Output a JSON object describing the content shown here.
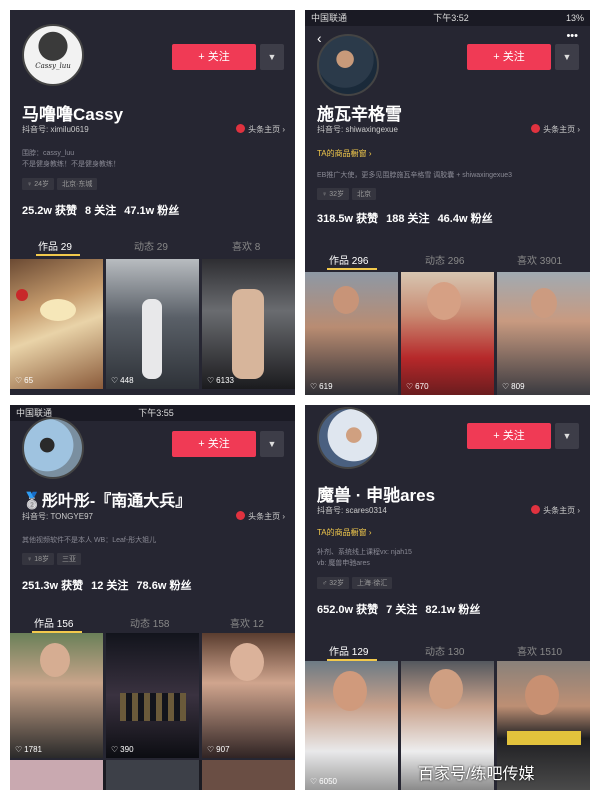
{
  "watermark": "百家号/练吧传媒",
  "labels": {
    "follow": "+ 关注",
    "dropdown": "▼",
    "toutiao": "头条主页 ›",
    "shop": "TA的商品橱窗 ›",
    "heart": "♡"
  },
  "status_bars": {
    "p2": {
      "carrier": "中国联通",
      "time": "下午3:52",
      "battery": "13%"
    },
    "p3": {
      "carrier": "中国联通",
      "time": "下午3:55"
    }
  },
  "profiles": [
    {
      "name": "马噜噜Cassy",
      "avatar_text": "Cassy_luu",
      "douyin_id": "抖音号: ximilu0619",
      "bio": [
        "围脖：cassy_luu",
        "不是健身教练！不是健身教练！"
      ],
      "tags": [
        "♀ 24岁",
        "北京·东城"
      ],
      "stats": [
        "25.2w 获赞",
        "8 关注",
        "47.1w 粉丝"
      ],
      "tabs": [
        "作品 29",
        "动态 29",
        "喜欢 8"
      ],
      "likes": [
        "65",
        "448",
        "6133"
      ]
    },
    {
      "name": "施瓦辛格雪",
      "douyin_id": "抖音号: shiwaxingexue",
      "bio": [
        "EB推广大使，更多见围脖施瓦辛格雪 调胶囊 + shiwaxingexue3"
      ],
      "tags": [
        "♀ 32岁",
        "北京"
      ],
      "stats": [
        "318.5w 获赞",
        "188 关注",
        "46.4w 粉丝"
      ],
      "tabs": [
        "作品 296",
        "动态 296",
        "喜欢 3901"
      ],
      "likes": [
        "619",
        "670",
        "809"
      ]
    },
    {
      "name": "🥈彤叶彤-『南通大兵』",
      "douyin_id": "抖音号: TONGYE97",
      "bio": [
        "其他视频软件不是本人 WB：Leaf-彤大姐儿"
      ],
      "tags": [
        "♀ 18岁",
        "三亚"
      ],
      "stats": [
        "251.3w 获赞",
        "12 关注",
        "78.6w 粉丝"
      ],
      "tabs": [
        "作品 156",
        "动态 158",
        "喜欢 12"
      ],
      "likes": [
        "1781",
        "390",
        "907"
      ]
    },
    {
      "name": "魔兽 · 申驰ares",
      "douyin_id": "抖音号: scares0314",
      "bio": [
        "补剂、系统线上课程vx: njah15",
        "vb: 魔兽申驰ares"
      ],
      "tags": [
        "♂ 32岁",
        "上海·徐汇"
      ],
      "stats": [
        "652.0w 获赞",
        "7 关注",
        "82.1w 粉丝"
      ],
      "tabs": [
        "作品 129",
        "动态 130",
        "喜欢 1510"
      ],
      "likes": [
        "6050",
        "",
        ""
      ]
    }
  ],
  "colors": {
    "panel_bg": "#262632",
    "follow_red": "#f03a55",
    "tab_underline": "#f2c94c",
    "shop_yellow": "#f2c94c"
  }
}
